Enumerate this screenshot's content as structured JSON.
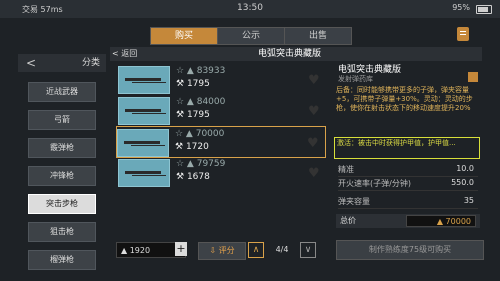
{
  "status": {
    "carrier": "交易 57ms",
    "time": "13:50",
    "battery": "95%"
  },
  "tabs": [
    "购买",
    "公示",
    "出售"
  ],
  "header": {
    "back": "返回",
    "title": "电弧突击典藏版"
  },
  "sidebar": {
    "title": "分类",
    "items": [
      "近战武器",
      "弓箭",
      "霰弹枪",
      "冲锋枪",
      "突击步枪",
      "狙击枪",
      "榴弹枪"
    ]
  },
  "listings": [
    {
      "old_price": "83933",
      "price": "1795"
    },
    {
      "old_price": "84000",
      "price": "1795"
    },
    {
      "old_price": "70000",
      "price": "1720"
    },
    {
      "old_price": "79759",
      "price": "1678"
    }
  ],
  "bottom": {
    "money": "1920",
    "plus": "+",
    "rate": "评分",
    "page": "4/4"
  },
  "detail": {
    "title": "电弧突击典藏版",
    "sub": "发射弹药库",
    "desc": "后备：同时能够携带更多的子弹，弹夹容量+5，可携带子弹量+30%。灵动：灵动的步枪，使你在射击状态下的移动速度提升20%",
    "highlight": "激活：被击中时获得护甲值，护甲值...",
    "stats": [
      {
        "k": "精准",
        "v": "10.0"
      },
      {
        "k": "开火速率(子弹/分钟)",
        "v": "550.0"
      },
      {
        "k": "弹夹容量",
        "v": "35"
      }
    ],
    "total_label": "总价",
    "total_value": "70000",
    "buy_text": "制作熟练度75级可购买"
  }
}
